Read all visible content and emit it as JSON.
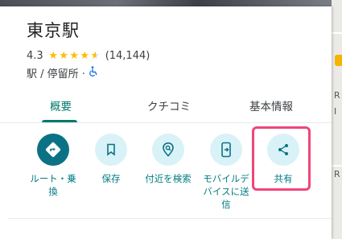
{
  "place": {
    "name": "東京駅",
    "rating": "4.3",
    "stars": 4.3,
    "review_count": "(14,144)",
    "category": "駅 / 停留所 ·"
  },
  "tabs": [
    {
      "label": "概要",
      "active": true
    },
    {
      "label": "クチコミ",
      "active": false
    },
    {
      "label": "基本情報",
      "active": false
    }
  ],
  "actions": [
    {
      "label": "ルート・乗\n換",
      "icon": "directions-icon"
    },
    {
      "label": "保存",
      "icon": "bookmark-icon"
    },
    {
      "label": "付近を検索",
      "icon": "nearby-search-icon"
    },
    {
      "label": "モバイルデ\nバイスに送\n信",
      "icon": "send-to-phone-icon"
    },
    {
      "label": "共有",
      "icon": "share-icon"
    }
  ],
  "map": {
    "labels": [
      "R",
      "I",
      "R"
    ]
  },
  "colors": {
    "accent": "#00796b",
    "primary_action": "#0b7285",
    "action_bg": "#d9f2f7",
    "highlight": "#f0457a",
    "star": "#fbbc04"
  }
}
